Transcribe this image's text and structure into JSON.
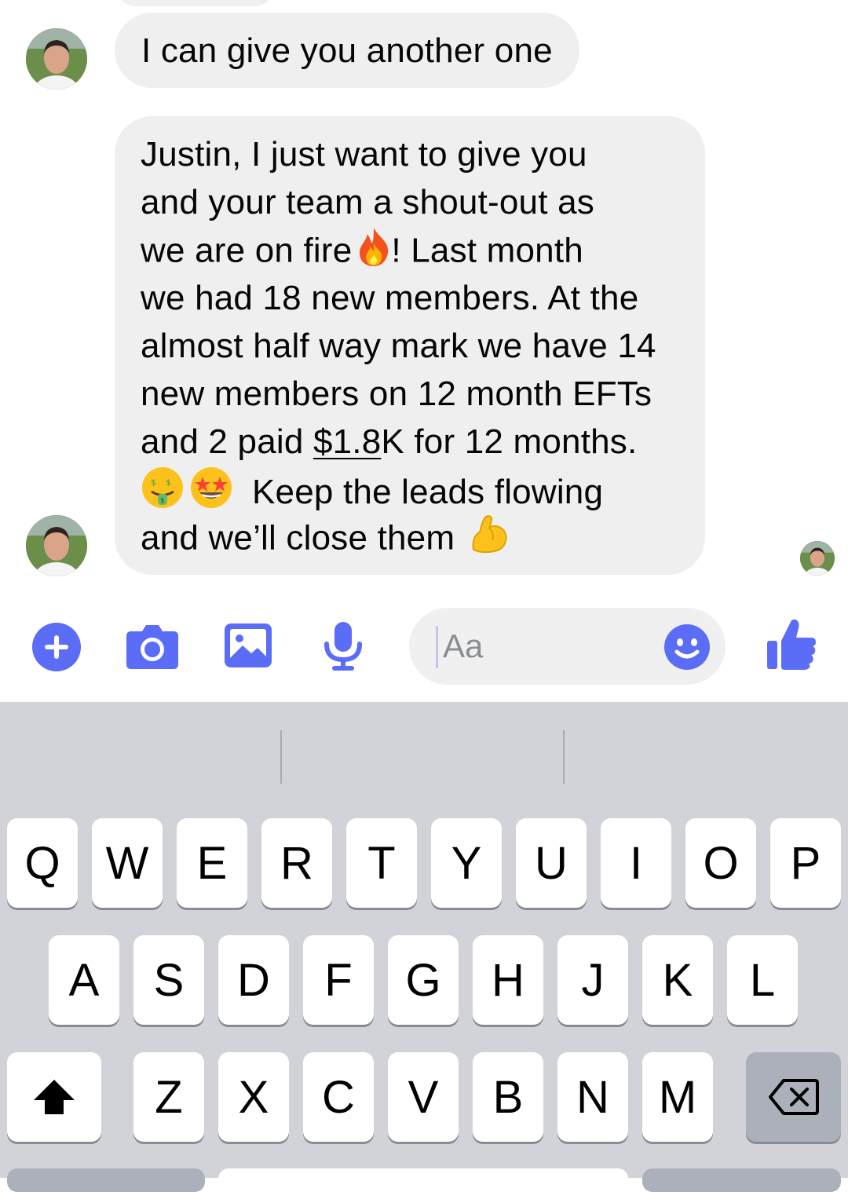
{
  "messages": [
    {
      "sender": "other",
      "text": "I can give you another one"
    },
    {
      "sender": "other",
      "lines": [
        "Justin, I just want to give you",
        "and your team a shout-out as",
        "we are on fire",
        "!  Last month",
        "we had 18 new members. At the",
        "almost half way mark we have 14",
        "new members on 12 month EFTs",
        "and 2 paid ",
        "$1.8",
        "K for 12 months.",
        "Keep the leads flowing",
        "and we’ll close them"
      ],
      "emojis": [
        "fire",
        "money-mouth-face",
        "star-struck-face",
        "flexed-biceps"
      ]
    }
  ],
  "composer": {
    "placeholder": "Aa",
    "icons": [
      "plus-icon",
      "camera-icon",
      "gallery-icon",
      "microphone-icon",
      "emoji-icon",
      "thumbs-up-icon"
    ],
    "accent_color": "#5b6cf7"
  },
  "keyboard": {
    "row1": [
      "Q",
      "W",
      "E",
      "R",
      "T",
      "Y",
      "U",
      "I",
      "O",
      "P"
    ],
    "row2": [
      "A",
      "S",
      "D",
      "F",
      "G",
      "H",
      "J",
      "K",
      "L"
    ],
    "row3": [
      "Z",
      "X",
      "C",
      "V",
      "B",
      "N",
      "M"
    ]
  }
}
